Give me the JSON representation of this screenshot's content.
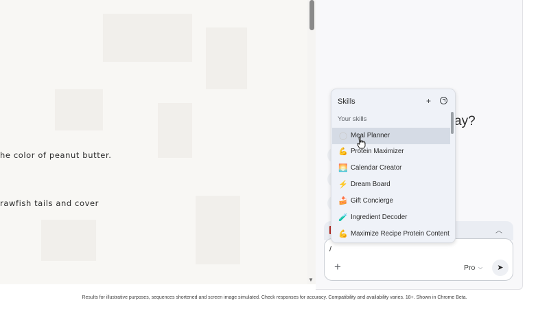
{
  "page": {
    "recipe_lines": [
      "he color of peanut butter.",
      "rawfish tails and cover"
    ]
  },
  "side_panel": {
    "greeting_partial": "ay?",
    "skills_popup": {
      "title": "Skills",
      "add_icon": "plus-icon",
      "explore_icon": "compass-icon",
      "section_label": "Your skills",
      "items": [
        {
          "label": "Meal Planner",
          "icon": "plate-icon",
          "glyph": "◯",
          "color": "#c9c9c9",
          "state": "hovered"
        },
        {
          "label": "Protein Maximizer",
          "icon": "flexed-biceps-icon",
          "glyph": "💪",
          "color": "#f2b01e"
        },
        {
          "label": "Calendar Creator",
          "icon": "sunrise-icon",
          "glyph": "🌅",
          "color": "#f08a4b"
        },
        {
          "label": "Dream Board",
          "icon": "lightning-icon",
          "glyph": "⚡",
          "color": "#e8453c"
        },
        {
          "label": "Gift Concierge",
          "icon": "cake-icon",
          "glyph": "🍰",
          "color": "#c98a2d"
        },
        {
          "label": "Ingredient Decoder",
          "icon": "test-tube-icon",
          "glyph": "🧪",
          "color": "#7cb342"
        },
        {
          "label": "Maximize Recipe Protein Content",
          "icon": "flexed-biceps-icon",
          "glyph": "💪",
          "color": "#f2b01e"
        }
      ]
    },
    "input": {
      "value": "/",
      "add_label": "+",
      "model_label": "Pro",
      "send_icon": "send-icon"
    }
  },
  "footer": {
    "disclaimer": "Results for illustrative purposes, sequences shortened and screen image simulated. Check responses for accuracy. Compatibility and availability varies. 18+. Shown in Chrome Beta."
  }
}
